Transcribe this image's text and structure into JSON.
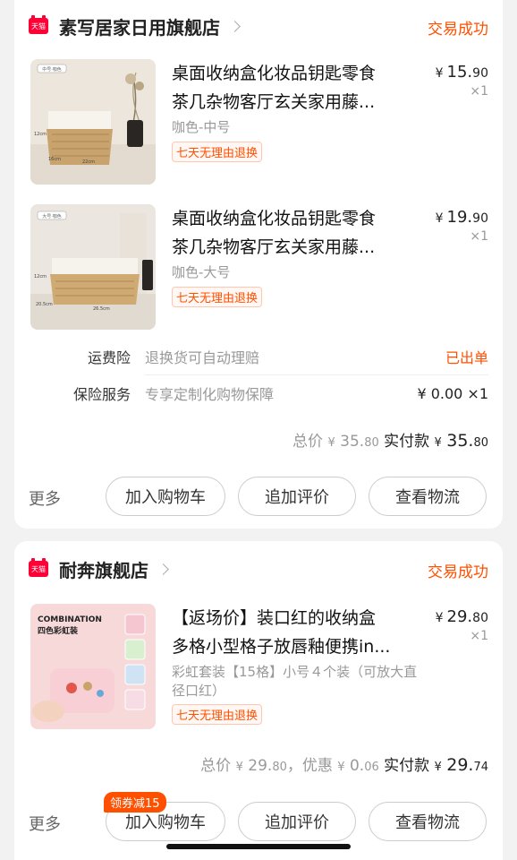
{
  "orders": [
    {
      "shop_name": "素写居家日用旗舰店",
      "status": "交易成功",
      "items": [
        {
          "title_line1": "桌面收纳盒化妆品钥匙零食",
          "title_line2": "茶几杂物客厅玄关家用藤...",
          "sku": "咖色-中号",
          "tag": "七天无理由退换",
          "price_int": "15.",
          "price_dec": "90",
          "qty": "×1",
          "thumb_label": "中号·咖色",
          "dim_side": "12cm",
          "dim_depth": "16cm",
          "dim_width": "22cm"
        },
        {
          "title_line1": "桌面收纳盒化妆品钥匙零食",
          "title_line2": "茶几杂物客厅玄关家用藤...",
          "sku": "咖色-大号",
          "tag": "七天无理由退换",
          "price_int": "19.",
          "price_dec": "90",
          "qty": "×1",
          "thumb_label": "大号·咖色",
          "dim_side": "12cm",
          "dim_depth": "20.5cm",
          "dim_width": "26.5cm"
        }
      ],
      "freight_label": "运费险",
      "freight_text": "退换货可自动理赔",
      "freight_status": "已出单",
      "insurance_label": "保险服务",
      "insurance_text": "专享定制化购物保障",
      "insurance_price": "¥ 0.00 ×1",
      "total_label": "总价",
      "total_int": "35.",
      "total_dec": "80",
      "paid_label": "实付款",
      "paid_int": "35.",
      "paid_dec": "80",
      "more": "更多",
      "btn_cart": "加入购物车",
      "btn_review": "追加评价",
      "btn_logistics": "查看物流"
    },
    {
      "shop_name": "耐奔旗舰店",
      "status": "交易成功",
      "item": {
        "title_line1": "【返场价】装口红的收纳盒",
        "title_line2": "多格小型格子放唇釉便携in...",
        "sku": "彩虹套装【15格】小号４个装（可放大直径口红）",
        "tag": "七天无理由退换",
        "price_int": "29.",
        "price_dec": "80",
        "qty": "×1",
        "thumb_brand": "COMBINATION",
        "thumb_sub": "四色彩虹装"
      },
      "total_label": "总价",
      "total_int": "29.",
      "total_dec": "80",
      "discount_label": "，优惠",
      "discount_int": "0.",
      "discount_dec": "06",
      "paid_label": "实付款",
      "paid_int": "29.",
      "paid_dec": "74",
      "coupon": "领券减15",
      "more": "更多",
      "btn_cart": "加入购物车",
      "btn_review": "追加评价",
      "btn_logistics": "查看物流"
    }
  ],
  "currency": "¥",
  "tmall_badge": "天猫",
  "colors": {
    "accent": "#ff5000",
    "tmall": "#ff0036"
  }
}
